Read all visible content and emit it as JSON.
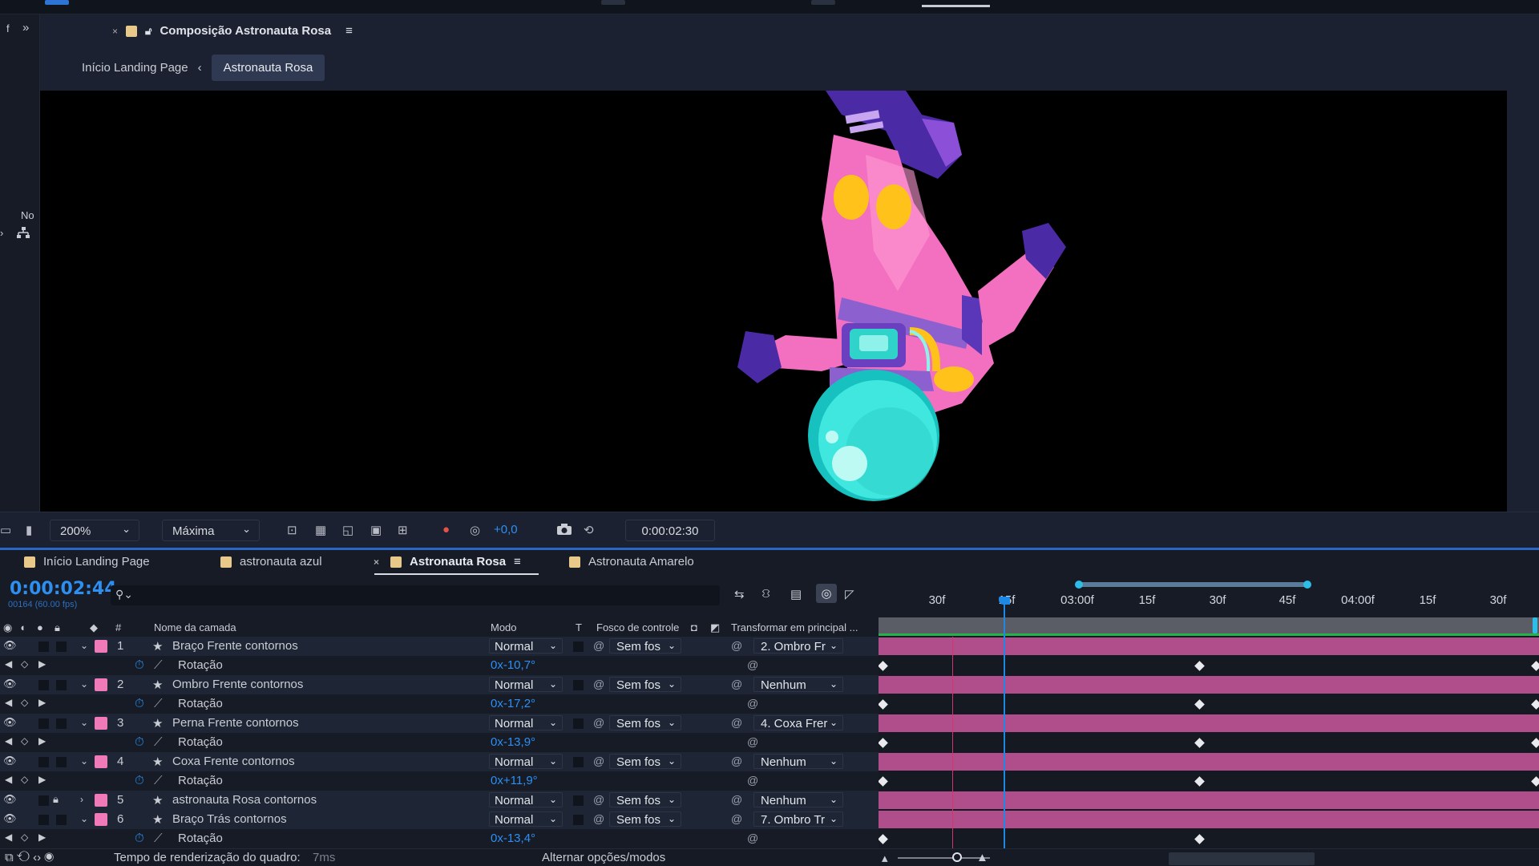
{
  "app": {
    "comp_panel_title": "Composição Astronauta Rosa",
    "left_gutter_label": "No",
    "left_gutter_top": "f"
  },
  "breadcrumbs": [
    {
      "label": "Início Landing Page"
    },
    {
      "label": "Astronauta Rosa"
    }
  ],
  "viewer_toolbar": {
    "zoom": "200%",
    "resolution": "Máxima",
    "exposure": "+0,0",
    "timecode": "0:00:02:30"
  },
  "timeline_tabs": [
    {
      "label": "Início Landing Page",
      "color": "#e8c98a"
    },
    {
      "label": "astronauta azul",
      "color": "#e8c98a"
    },
    {
      "label": "Astronauta Rosa",
      "color": "#e8c98a",
      "active": true
    },
    {
      "label": "Astronauta Amarelo",
      "color": "#e8c98a"
    }
  ],
  "timeline": {
    "current_time": "0:00:02:44",
    "current_frames": "00164 (60.00 fps)",
    "search_placeholder": "",
    "ruler_labels": [
      "30f",
      "15f",
      "03:00f",
      "15f",
      "30f",
      "45f",
      "04:00f",
      "15f",
      "30f"
    ]
  },
  "columns": {
    "num": "#",
    "name": "Nome da camada",
    "mode": "Modo",
    "t": "T",
    "track": "Fosco de controle",
    "parent": "Transformar em principal ..."
  },
  "layers": [
    {
      "num": "1",
      "name": "Braço Frente contornos",
      "mode": "Normal",
      "track": "Sem fos",
      "parent": "2. Ombro Fr",
      "prop": "Rotação",
      "value": "0x-10,7°",
      "locked": false,
      "expanded": true
    },
    {
      "num": "2",
      "name": "Ombro Frente contornos",
      "mode": "Normal",
      "track": "Sem fos",
      "parent": "Nenhum",
      "prop": "Rotação",
      "value": "0x-17,2°",
      "locked": false,
      "expanded": true
    },
    {
      "num": "3",
      "name": "Perna Frente contornos",
      "mode": "Normal",
      "track": "Sem fos",
      "parent": "4. Coxa Frer",
      "prop": "Rotação",
      "value": "0x-13,9°",
      "locked": false,
      "expanded": true
    },
    {
      "num": "4",
      "name": "Coxa Frente contornos",
      "mode": "Normal",
      "track": "Sem fos",
      "parent": "Nenhum",
      "prop": "Rotação",
      "value": "0x+11,9°",
      "locked": false,
      "expanded": true
    },
    {
      "num": "5",
      "name": "astronauta Rosa contornos",
      "mode": "Normal",
      "track": "Sem fos",
      "parent": "Nenhum",
      "locked": true,
      "expanded": false
    },
    {
      "num": "6",
      "name": "Braço Trás contornos",
      "mode": "Normal",
      "track": "Sem fos",
      "parent": "7. Ombro Tr",
      "prop": "Rotação",
      "value": "0x-13,4°",
      "locked": false,
      "expanded": true
    }
  ],
  "status": {
    "render_label": "Tempo de renderização do quadro:",
    "render_value": "7ms",
    "toggle_label": "Alternar opções/modos"
  },
  "colors": {
    "accent_blue": "#2d8ff0",
    "layer_label_pink": "#f07ab9",
    "track_bar": "#b04e8c",
    "playhead": "#1e88e5"
  }
}
